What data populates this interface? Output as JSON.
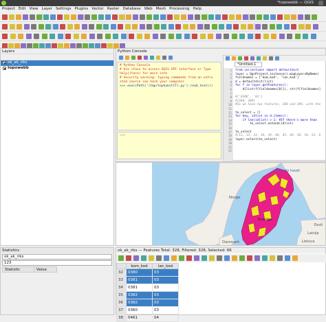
{
  "window": {
    "title": "*topowebb — QGIS"
  },
  "menu": [
    "Project",
    "Edit",
    "View",
    "Layer",
    "Settings",
    "Plugins",
    "Vector",
    "Raster",
    "Database",
    "Web",
    "Mesh",
    "Processing",
    "Help"
  ],
  "layers_panel": {
    "title": "Layers",
    "layers": [
      {
        "name": "ok_ak_riks",
        "checked": true,
        "selected": true
      },
      {
        "name": "topowebb",
        "checked": true,
        "selected": false
      }
    ]
  },
  "statistics_panel": {
    "title": "Statistics",
    "layer_value": "ok_ak_riks",
    "field_value": "123",
    "columns": [
      "Statistic",
      "Value"
    ]
  },
  "python_console": {
    "title": "Python Console",
    "output_lines": [
      "# Python Console",
      "# Use iface to access QGIS API interface or Type",
      "help(iface) for more info",
      "# Security warning: typing commands from an untru",
      "sted source can harm your computer",
      ">>> exec(Path('/tmp/tophuksttT].py').read_text())"
    ],
    "input_prompt": ">>>"
  },
  "editor": {
    "tab_label": "*Untitled-1",
    "line_numbers": [
      "1",
      "2",
      "3",
      "4",
      "5",
      "6",
      "7",
      "8",
      "9",
      "10",
      "11",
      "12",
      "13",
      "14",
      "15",
      "16",
      "17",
      "18",
      "19",
      "20",
      "21",
      "22"
    ],
    "code_lines": [
      "from collections import defaultdict",
      "layer = QgsProject.instance().mapLayersByName(",
      "fieldnames = ['kom_kod', 'lan_kod']",
      "d = defaultdict(list)",
      "for f in layer.getFeatures():",
      "    d[list(f[fieldnames[0]]), str(f[fieldnames]",
      "",
      "#{'0380', '03'}",
      "#{280, 289}",
      "#So we have two features, 280 and 289, with the",
      "",
      "to_select = []",
      "for key, idlist in d.items():",
      "    if len(idlist) > 1: #If there's more than",
      "        to_select.extend(idlist)",
      "",
      "to_select",
      "#[11, 12, 33, 34, 39, 44, 45, 49, 50, 54, 53, 6",
      "layer.select(to_select)",
      "",
      "",
      ""
    ]
  },
  "map": {
    "labels": [
      "Barents havet",
      "Norge",
      "Sverige",
      "Danmark",
      "Lietuva",
      "Latvija",
      "Eesti"
    ]
  },
  "attribute_table": {
    "title": "ok_ak_riks — Features Total: 328, Filtered: 328, Selected: 66",
    "columns": [
      "kom_kod",
      "lan_kod"
    ],
    "rows": [
      {
        "num": "32",
        "kom_kod": "0380",
        "lan_kod": "03",
        "selected": true
      },
      {
        "num": "33",
        "kom_kod": "0381",
        "lan_kod": "03",
        "selected": true
      },
      {
        "num": "34",
        "kom_kod": "0381",
        "lan_kod": "03",
        "selected": false
      },
      {
        "num": "35",
        "kom_kod": "0382",
        "lan_kod": "03",
        "selected": true
      },
      {
        "num": "36",
        "kom_kod": "0382",
        "lan_kod": "03",
        "selected": true
      },
      {
        "num": "37",
        "kom_kod": "0360",
        "lan_kod": "03",
        "selected": false
      },
      {
        "num": "38",
        "kom_kod": "0461",
        "lan_kod": "04",
        "selected": false
      }
    ]
  },
  "colors": {
    "selection_blue": "#3a7fc4",
    "console_bg": "#ffffce",
    "map_selected": "#e81f8a",
    "map_unselected": "#f5e62a",
    "water": "#a8d4f0"
  }
}
